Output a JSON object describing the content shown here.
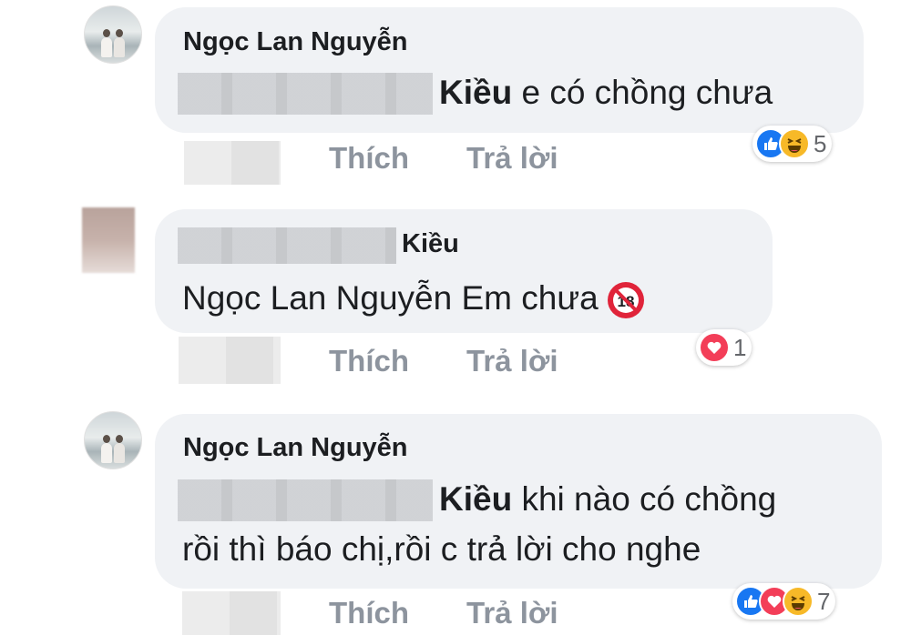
{
  "comments": [
    {
      "author": "Ngọc Lan Nguyễn",
      "mention": "Kiều",
      "text_line1": " e có chồng chưa",
      "text_line2": "",
      "actions": {
        "like": "Thích",
        "reply": "Trả lời"
      },
      "reactions": {
        "icons": [
          "like-icon",
          "haha-icon"
        ],
        "count": "5"
      }
    },
    {
      "author": "Kiều",
      "mention": "Ngọc Lan Nguyễn",
      "text_line1": " Em chưa",
      "text_line2": "",
      "emoji": "no-under-18-icon",
      "emoji_text": "18",
      "actions": {
        "like": "Thích",
        "reply": "Trả lời"
      },
      "reactions": {
        "icons": [
          "love-icon"
        ],
        "count": "1"
      }
    },
    {
      "author": "Ngọc Lan Nguyễn",
      "mention": "Kiều",
      "text_line1": " khi nào có chồng",
      "text_line2": "rồi thì báo chị,rồi c trả lời cho nghe",
      "actions": {
        "like": "Thích",
        "reply": "Trả lời"
      },
      "reactions": {
        "icons": [
          "like-icon",
          "love-icon",
          "haha-icon"
        ],
        "count": "7"
      }
    }
  ],
  "colors": {
    "bubble": "#f0f2f5",
    "text": "#1c1e21",
    "action": "#8d949e",
    "like": "#1877f2",
    "love": "#f33e58",
    "haha": "#f7b928"
  }
}
